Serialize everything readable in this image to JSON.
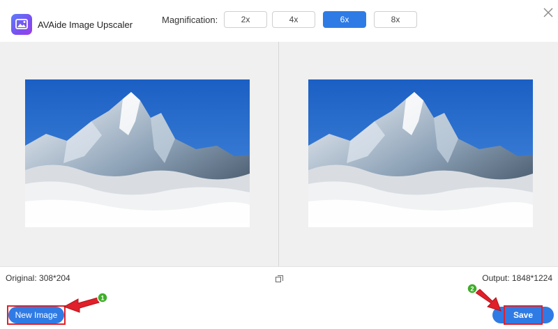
{
  "app": {
    "title": "AVAide Image Upscaler"
  },
  "magnification": {
    "label": "Magnification:",
    "options": [
      "2x",
      "4x",
      "6x",
      "8x"
    ],
    "selected": "6x"
  },
  "info": {
    "original": "Original: 308*204",
    "output": "Output: 1848*1224"
  },
  "footer": {
    "new_image_label": "New Image",
    "save_label": "Save"
  },
  "annotations": {
    "step1": "1",
    "step2": "2"
  },
  "colors": {
    "accent": "#2f7be5",
    "highlight": "#e0202a",
    "marker": "#3fae2a"
  },
  "icons": [
    "app-logo-icon",
    "close-icon",
    "compare-icon"
  ]
}
